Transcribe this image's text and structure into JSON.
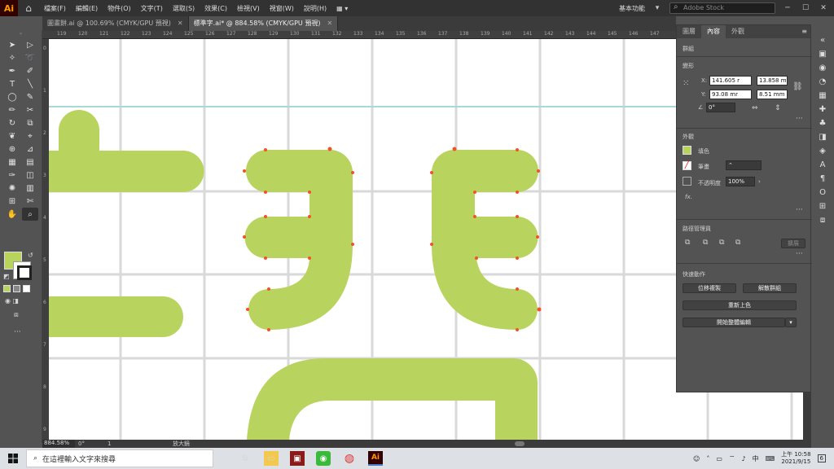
{
  "app": {
    "logo": "Ai",
    "home_icon": "home-icon"
  },
  "menu": [
    "檔案(F)",
    "編輯(E)",
    "物件(O)",
    "文字(T)",
    "選取(S)",
    "效果(C)",
    "檢視(V)",
    "視窗(W)",
    "說明(H)"
  ],
  "workspace": "基本功能",
  "stock_placeholder": "Adobe Stock",
  "doc_tabs": [
    {
      "label": "圖畫餅.ai @ 100.69% (CMYK/GPU 預視)",
      "active": false
    },
    {
      "label": "標準字.ai* @ 884.58% (CMYK/GPU 預視)",
      "active": true
    }
  ],
  "ruler": [
    "119",
    "120",
    "121",
    "122",
    "123",
    "124",
    "125",
    "126",
    "127",
    "128",
    "129",
    "130",
    "131",
    "132",
    "133",
    "134",
    "135",
    "136",
    "137",
    "138",
    "139",
    "140",
    "141",
    "142",
    "143",
    "144",
    "145",
    "146",
    "147",
    "148",
    "149"
  ],
  "ruler_left": [
    "0",
    "1",
    "2",
    "3",
    "4",
    "5",
    "6",
    "7",
    "8",
    "9"
  ],
  "status": {
    "zoom": "884.58%",
    "rotation": "0°",
    "artboard": "1",
    "tool": "放大鏡"
  },
  "panel": {
    "tabs": [
      "圖層",
      "內容",
      "外觀"
    ],
    "group_label": "群組",
    "transform_label": "變形",
    "x_label": "X:",
    "x_value": "141.605 r",
    "y_label": "Y:",
    "y_value": "93.08 mr",
    "w_label": "寬：",
    "w_value": "13.858 m",
    "h_label": "高：",
    "h_value": "8.51 mm",
    "angle_value": "0°",
    "appearance_label": "外觀",
    "fill_label": "填色",
    "stroke_label": "筆畫",
    "opacity_label": "不透明度",
    "opacity_value": "100%",
    "fx_label": "fx.",
    "pathfinder_label": "路徑管理員",
    "expand_label": "擴展",
    "quick_actions_label": "快速動作",
    "offset_copy": "位移複製",
    "ungroup": "解散群組",
    "recolor": "重新上色",
    "isolate": "開始整體編輯",
    "fill_color": "#b9d35f"
  },
  "taskbar": {
    "search_placeholder": "在這裡輸入文字來搜尋",
    "time": "上午 10:58",
    "date": "2021/9/15",
    "ime": "中",
    "notif_count": "6"
  },
  "colors": {
    "shape": "#b9d35f",
    "anchor": "#f0532a",
    "grid": "#d9d9d9",
    "guide": "#a8d8d8"
  }
}
